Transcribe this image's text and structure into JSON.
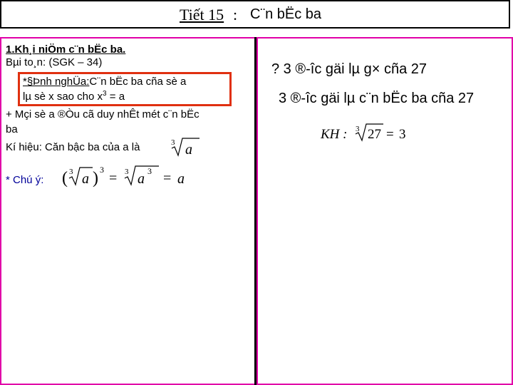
{
  "title": {
    "prefix": "Tiết 15",
    "colon": ":",
    "main": "C¨n bËc ba"
  },
  "left": {
    "section_heading": "1.Kh¸i niÖm c¨n bËc ba.",
    "problem_line": "Bµi to¸n: (SGK – 34)",
    "definition_label": "*§Þnh nghÜa:",
    "definition_text": "C¨n bËc ba cña sè a",
    "definition_line2_start": "lµ sè x sao cho x",
    "definition_line2_sup": "3",
    "definition_line2_end": " = a",
    "every_number_line1": "+ Mçi sè a ®Òu cã duy nhÊt mét c¨n bËc",
    "every_number_line2": "ba",
    "notation_text": "Kí hiệu: Căn bậc ba của a là",
    "notation_index": "3",
    "notation_radicand": "a",
    "note_label": "* Chú ý:",
    "note_formula": {
      "index_1": "3",
      "radicand_1": "a",
      "exp_1": "3",
      "equals_1": "=",
      "index_2": "3",
      "radicand_2": "a",
      "exp_2": "3",
      "equals_2": "=",
      "result": "a"
    }
  },
  "right": {
    "question_line": "? 3 ®-îc gäi lµ g× cña 27",
    "answer_line": "3 ®-îc gäi lµ c¨n bËc ba cña 27",
    "kh_formula": {
      "prefix": "KH :",
      "index": "3",
      "radicand": "27",
      "equals": "=",
      "result": "3"
    }
  }
}
